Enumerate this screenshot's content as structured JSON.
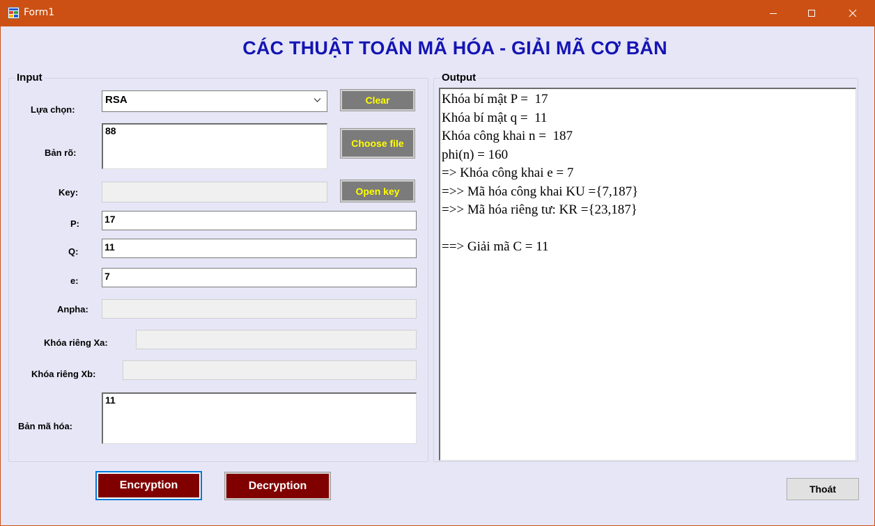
{
  "window": {
    "title": "Form1",
    "icon": "winforms-app-icon",
    "controls": [
      "minimize-icon",
      "maximize-icon",
      "close-icon"
    ]
  },
  "heading": "CÁC THUẬT TOÁN MÃ HÓA - GIẢI MÃ CƠ BẢN",
  "input_group": {
    "label": "Input",
    "algorithm_label": "Lựa chọn:",
    "algorithm_value": "RSA",
    "plaintext_label": "Bản rõ:",
    "plaintext_value": "88",
    "key_label": "Key:",
    "key_value": "",
    "p_label": "P:",
    "p_value": "17",
    "q_label": "Q:",
    "q_value": "11",
    "e_label": "e:",
    "e_value": "7",
    "anpha_label": "Anpha:",
    "anpha_value": "",
    "xa_label": "Khóa riêng Xa:",
    "xa_value": "",
    "xb_label": "Khóa riêng Xb:",
    "xb_value": "",
    "ciphertext_label": "Bản mã hóa:",
    "ciphertext_value": "11",
    "clear_button": "Clear",
    "choose_file_button": "Choose file",
    "open_key_button": "Open key"
  },
  "output_group": {
    "label": "Output",
    "lines": [
      "Khóa bí mật P =  17",
      "Khóa bí mật q =  11",
      "Khóa công khai n =  187",
      "phi(n) = 160",
      "=> Khóa công khai e = 7",
      "=>> Mã hóa công khai KU ={7,187}",
      "=>> Mã hóa riêng tư: KR ={23,187}",
      "",
      "==> Giải mã C = 11"
    ]
  },
  "actions": {
    "encrypt_button": "Encryption",
    "decrypt_button": "Decryption",
    "exit_button": "Thoát"
  },
  "colors": {
    "titlebar": "#cc5014",
    "form_background": "#e6e6f7",
    "heading_text": "#1414b4",
    "gray_button": "#7b7b7b",
    "gray_button_text": "#ffff00",
    "action_button": "#800000",
    "focus_border": "#0078d7"
  }
}
